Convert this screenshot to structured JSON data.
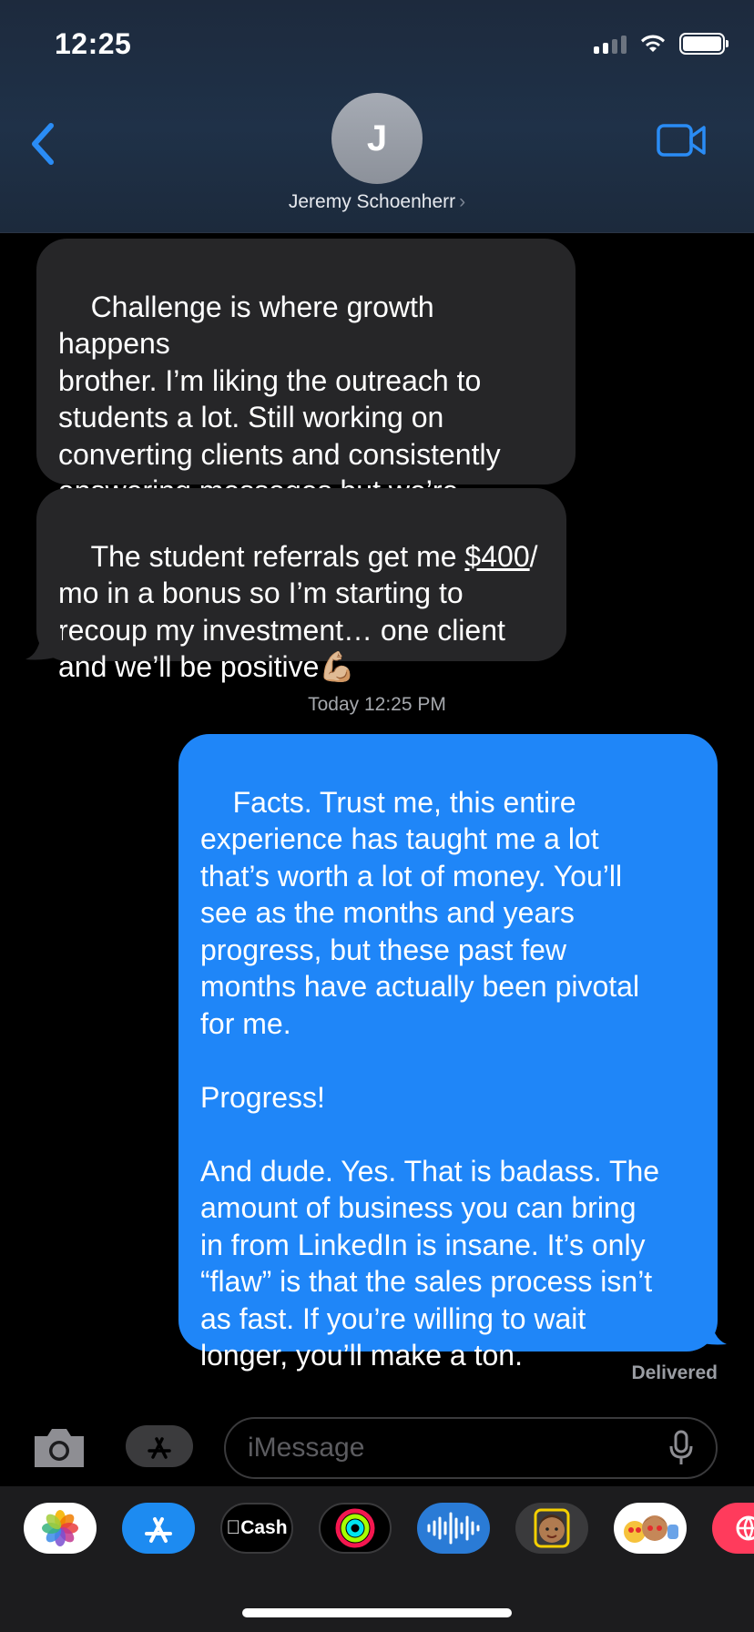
{
  "status_bar": {
    "time": "12:25"
  },
  "header": {
    "avatar_initial": "J",
    "contact_name": "Jeremy Schoenherr"
  },
  "messages": {
    "incoming_1": "Challenge is where growth happens\nbrother. I’m liking the outreach to\nstudents a lot. Still working on\nconverting clients and consistently\nanswering messages but we’re\ngetting there",
    "incoming_2_before": "The student referrals get me ",
    "incoming_2_link": "$400",
    "incoming_2_after": "/\nmo in a bonus so I’m starting to\nrecoup my investment… one client\nand we’ll be positive💪🏼",
    "timestamp": "Today 12:25 PM",
    "outgoing_1": "Facts. Trust me, this entire\nexperience has taught me a lot\nthat’s worth a lot of money. You’ll\nsee as the months and years\nprogress, but these past few\nmonths have actually been pivotal\nfor me.\n\nProgress!\n\nAnd dude. Yes. That is badass. The\namount of business you can bring\nin from LinkedIn is insane. It’s only\n“flaw” is that the sales process isn’t\nas fast. If you’re willing to wait\nlonger, you’ll make a ton.",
    "delivered": "Delivered"
  },
  "input": {
    "placeholder": "iMessage"
  },
  "app_drawer": {
    "apps": [
      {
        "icon": "photos-icon"
      },
      {
        "icon": "app-store-icon"
      },
      {
        "icon": "apple-cash-icon",
        "label": "Cash"
      },
      {
        "icon": "activity-icon"
      },
      {
        "icon": "audio-message-icon"
      },
      {
        "icon": "memoji-icon"
      },
      {
        "icon": "animoji-stickers-icon"
      },
      {
        "icon": "web-icon"
      }
    ]
  },
  "colors": {
    "accent_blue": "#1f86f8",
    "incoming_bubble": "#262628",
    "header_bg": "#1f3148",
    "ios_blue_icon": "#2a8cf5"
  }
}
